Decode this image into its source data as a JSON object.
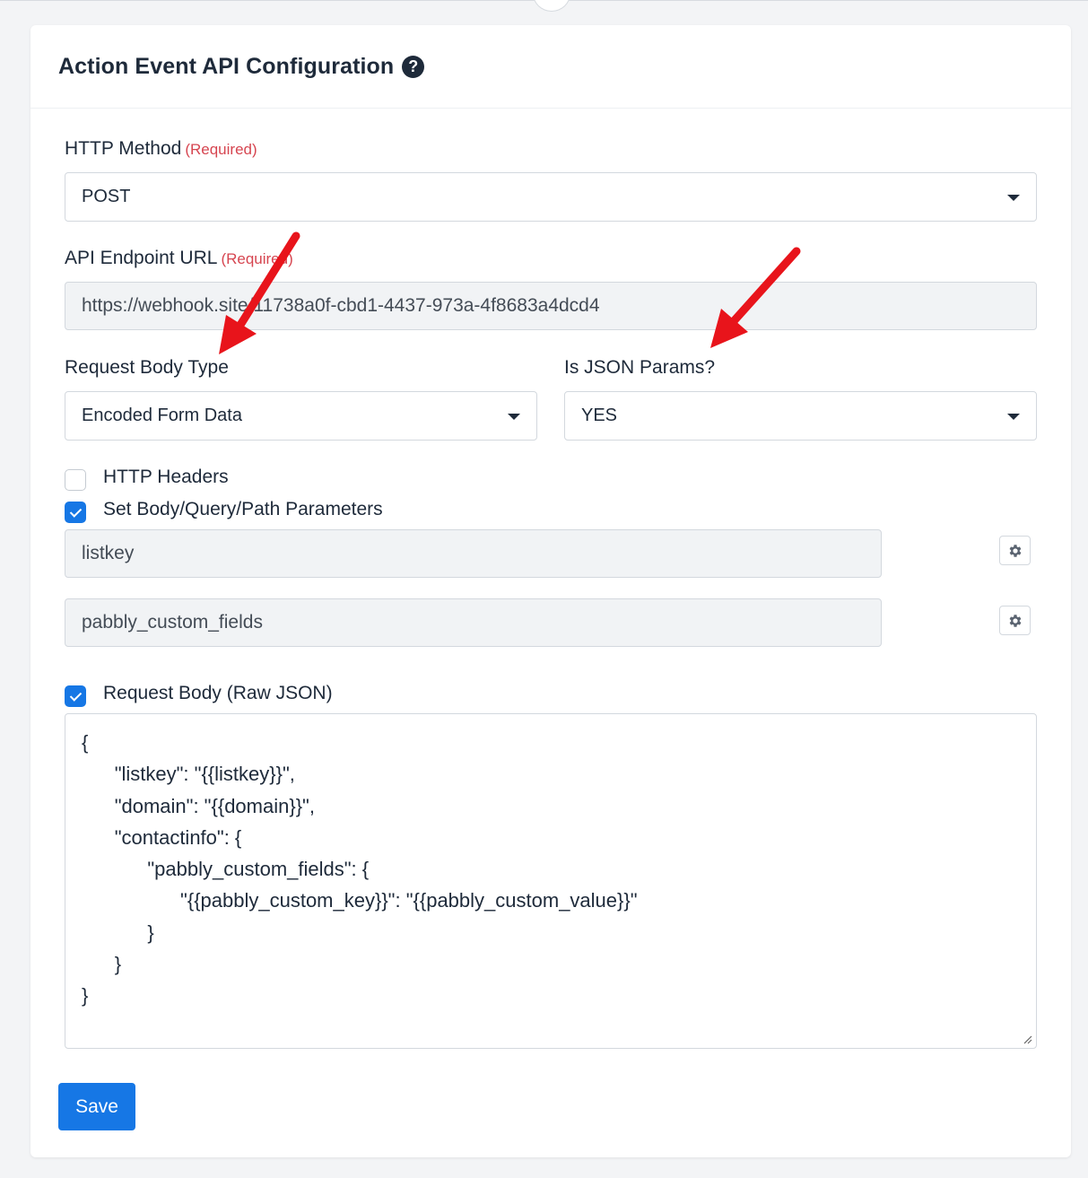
{
  "header": {
    "title": "Action Event API Configuration",
    "help_icon": "question-circle-icon"
  },
  "required_text": "(Required)",
  "http_method": {
    "label": "HTTP Method",
    "value": "POST"
  },
  "endpoint": {
    "label": "API Endpoint URL",
    "value": "https://webhook.site/11738a0f-cbd1-4437-973a-4f8683a4dcd4"
  },
  "body_type": {
    "label": "Request Body Type",
    "value": "Encoded Form Data"
  },
  "json_params": {
    "label": "Is JSON Params?",
    "value": "YES"
  },
  "http_headers": {
    "label": "HTTP Headers",
    "checked": false
  },
  "set_params": {
    "label": "Set Body/Query/Path Parameters",
    "checked": true,
    "params": [
      "listkey",
      "pabbly_custom_fields"
    ]
  },
  "raw_json": {
    "label": "Request Body (Raw JSON)",
    "checked": true,
    "value": "{\n\t\"listkey\": \"{{listkey}}\",\n\t\"domain\": \"{{domain}}\",\n\t\"contactinfo\": {\n\t\t\"pabbly_custom_fields\": {\n\t\t\t\"{{pabbly_custom_key}}\": \"{{pabbly_custom_value}}\"\n\t\t}\n\t}\n}"
  },
  "save_label": "Save",
  "colors": {
    "accent": "#1677e5",
    "required": "#d64550",
    "annotation_arrow": "#e8141b"
  }
}
